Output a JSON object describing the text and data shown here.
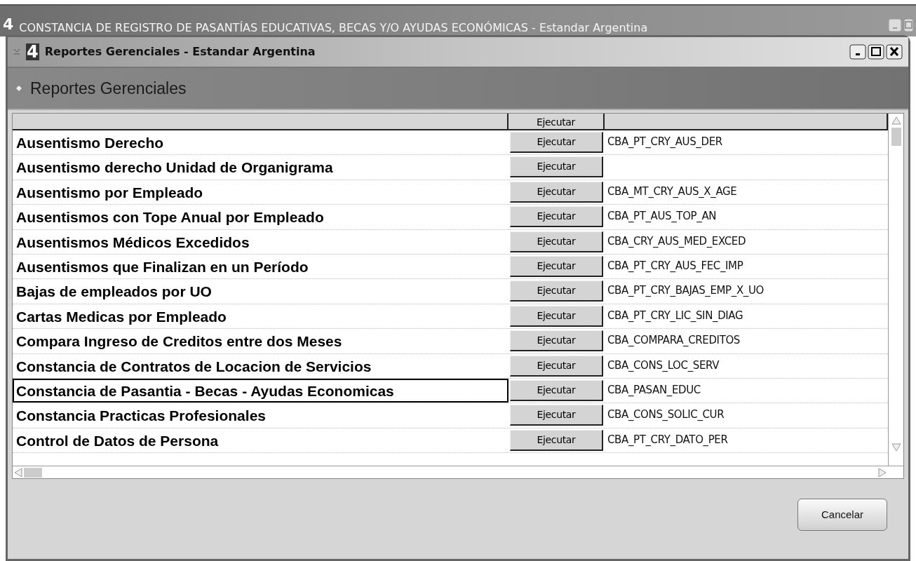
{
  "background_window": {
    "logo": "4",
    "title": "CONSTANCIA DE REGISTRO DE PASANTÍAS EDUCATIVAS, BECAS Y/O AYUDAS ECONÓMICAS - Estandar Argentina"
  },
  "window": {
    "logo": "4",
    "title": "Reportes Gerenciales - Estandar Argentina"
  },
  "header": {
    "title": "Reportes Gerenciales"
  },
  "table": {
    "columns": [
      "",
      "Ejecutar",
      ""
    ],
    "rows": [
      {
        "name": "Ausentismo Derecho",
        "action": "Ejecutar",
        "code": "CBA_PT_CRY_AUS_DER",
        "selected": false
      },
      {
        "name": "Ausentismo derecho Unidad de Organigrama",
        "action": "Ejecutar",
        "selected": false
      },
      {
        "name": "Ausentismo por Empleado",
        "action": "Ejecutar",
        "code": "CBA_MT_CRY_AUS_X_AGE",
        "selected": false
      },
      {
        "name": "Ausentismos con Tope Anual por Empleado",
        "action": "Ejecutar",
        "code": "CBA_PT_AUS_TOP_AN",
        "selected": false
      },
      {
        "name": "Ausentismos Médicos Excedidos",
        "action": "Ejecutar",
        "code": "CBA_CRY_AUS_MED_EXCED",
        "selected": false
      },
      {
        "name": "Ausentismos que Finalizan en un Período",
        "action": "Ejecutar",
        "code": "CBA_PT_CRY_AUS_FEC_IMP",
        "selected": false
      },
      {
        "name": "Bajas de empleados por UO",
        "action": "Ejecutar",
        "code": "CBA_PT_CRY_BAJAS_EMP_X_UO",
        "selected": false
      },
      {
        "name": "Cartas Medicas por Empleado",
        "action": "Ejecutar",
        "code": "CBA_PT_CRY_LIC_SIN_DIAG",
        "selected": false
      },
      {
        "name": "Compara Ingreso de Creditos entre dos Meses",
        "action": "Ejecutar",
        "code": "CBA_COMPARA_CREDITOS",
        "selected": false
      },
      {
        "name": "Constancia de Contratos de Locacion de Servicios",
        "action": "Ejecutar",
        "code": "CBA_CONS_LOC_SERV",
        "selected": false
      },
      {
        "name": "Constancia de Pasantia - Becas - Ayudas Economicas",
        "action": "Ejecutar",
        "code": "CBA_PASAN_EDUC",
        "selected": true
      },
      {
        "name": "Constancia Practicas Profesionales",
        "action": "Ejecutar",
        "code": "CBA_CONS_SOLIC_CUR",
        "selected": false
      },
      {
        "name": "Control de Datos de Persona",
        "action": "Ejecutar",
        "code": "CBA_PT_CRY_DATO_PER",
        "selected": false
      }
    ]
  },
  "buttons": [
    "Cancelar"
  ]
}
